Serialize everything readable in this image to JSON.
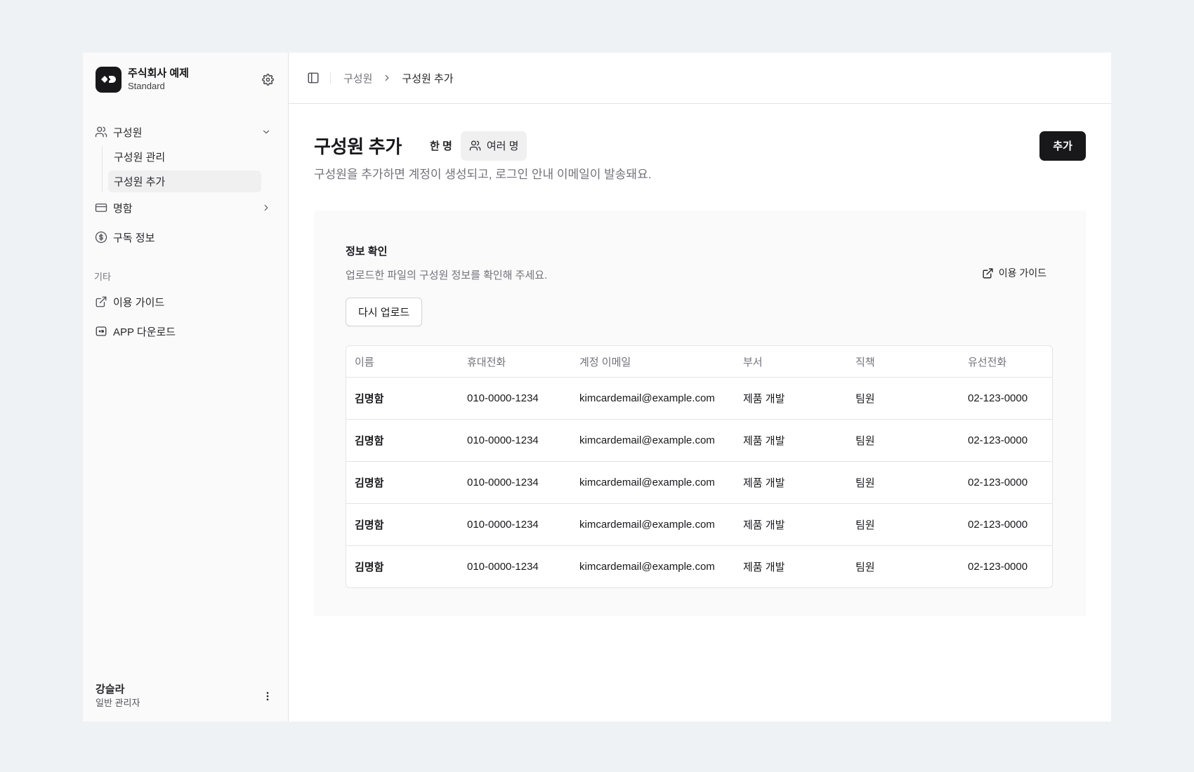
{
  "sidebar": {
    "brand_name": "주식회사 예제",
    "brand_plan": "Standard",
    "members_label": "구성원",
    "sub_items": [
      "구성원 관리",
      "구성원 추가"
    ],
    "cards_label": "명함",
    "subscription_label": "구독 정보",
    "section_other": "기타",
    "guide_label": "이용 가이드",
    "app_label": "APP 다운로드",
    "user_name": "강슬라",
    "user_role": "일반 관리자"
  },
  "topbar": {
    "crumb_parent": "구성원",
    "crumb_current": "구성원 추가"
  },
  "main": {
    "title": "구성원 추가",
    "seg_single": "한 명",
    "seg_multi": "여러 명",
    "add_button": "추가",
    "description": "구성원을 추가하면 계정이 생성되고, 로그인 안내 이메일이 발송돼요."
  },
  "card": {
    "title": "정보 확인",
    "description": "업로드한 파일의 구성원 정보를 확인해 주세요.",
    "guide_link": "이용 가이드",
    "reupload_button": "다시 업로드",
    "columns": [
      "이름",
      "휴대전화",
      "계정 이메일",
      "부서",
      "직책",
      "유선전화"
    ],
    "rows": [
      [
        "김명함",
        "010-0000-1234",
        "kimcardemail@example.com",
        "제품 개발",
        "팀원",
        "02-123-0000"
      ],
      [
        "김명함",
        "010-0000-1234",
        "kimcardemail@example.com",
        "제품 개발",
        "팀원",
        "02-123-0000"
      ],
      [
        "김명함",
        "010-0000-1234",
        "kimcardemail@example.com",
        "제품 개발",
        "팀원",
        "02-123-0000"
      ],
      [
        "김명함",
        "010-0000-1234",
        "kimcardemail@example.com",
        "제품 개발",
        "팀원",
        "02-123-0000"
      ],
      [
        "김명함",
        "010-0000-1234",
        "kimcardemail@example.com",
        "제품 개발",
        "팀원",
        "02-123-0000"
      ]
    ]
  },
  "colors": {
    "background": "#eff2f5",
    "sidebar": "#fafafa",
    "primary": "#18181b",
    "muted_text": "#71717a"
  },
  "icons": [
    "gear-icon",
    "users-icon",
    "chevron-down-icon",
    "chevron-right-icon",
    "card-icon",
    "dollar-circle-icon",
    "external-link-icon",
    "app-icon",
    "more-vertical-icon",
    "sidebar-toggle-icon"
  ]
}
